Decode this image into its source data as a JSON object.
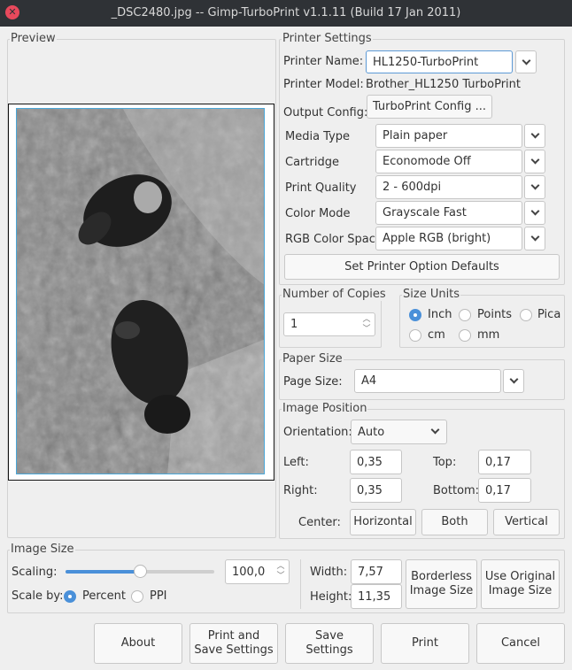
{
  "window": {
    "title": "_DSC2480.jpg -- Gimp-TurboPrint v1.1.11 (Build 17 Jan 2011)"
  },
  "preview": {
    "label": "Preview"
  },
  "printer_settings": {
    "label": "Printer Settings",
    "printer_name_label": "Printer Name:",
    "printer_name_value": "HL1250-TurboPrint",
    "printer_model_label": "Printer Model:",
    "printer_model_value": "Brother_HL1250 TurboPrint",
    "output_config_label": "Output Config:",
    "output_config_button": "TurboPrint Config ...",
    "media_type_label": "Media Type",
    "media_type_value": "Plain paper",
    "cartridge_label": "Cartridge",
    "cartridge_value": "Economode Off",
    "print_quality_label": "Print Quality",
    "print_quality_value": "2 - 600dpi",
    "color_mode_label": "Color Mode",
    "color_mode_value": "Grayscale Fast",
    "rgb_color_space_label": "RGB Color Space",
    "rgb_color_space_value": "Apple RGB (bright)",
    "defaults_button": "Set Printer Option Defaults"
  },
  "copies": {
    "label": "Number of Copies",
    "value": "1"
  },
  "size_units": {
    "label": "Size Units",
    "options": [
      "Inch",
      "Points",
      "Pica",
      "cm",
      "mm"
    ],
    "selected": "Inch"
  },
  "paper_size": {
    "label": "Paper Size",
    "page_size_label": "Page Size:",
    "page_size_value": "A4"
  },
  "image_position": {
    "label": "Image Position",
    "orientation_label": "Orientation:",
    "orientation_value": "Auto",
    "left_label": "Left:",
    "left_value": "0,35",
    "top_label": "Top:",
    "top_value": "0,17",
    "right_label": "Right:",
    "right_value": "0,35",
    "bottom_label": "Bottom:",
    "bottom_value": "0,17",
    "center_label": "Center:",
    "horizontal_button": "Horizontal",
    "both_button": "Both",
    "vertical_button": "Vertical"
  },
  "image_size": {
    "label": "Image Size",
    "scaling_label": "Scaling:",
    "scaling_value": "100,0",
    "scaling_fraction": 0.5,
    "scale_by_label": "Scale by:",
    "scale_by_options": [
      "Percent",
      "PPI"
    ],
    "scale_by_selected": "Percent",
    "width_label": "Width:",
    "width_value": "7,57",
    "height_label": "Height:",
    "height_value": "11,35",
    "borderless_button_line1": "Borderless",
    "borderless_button_line2": "Image Size",
    "original_button_line1": "Use Original",
    "original_button_line2": "Image Size"
  },
  "footer": {
    "about": "About",
    "print_save_line1": "Print and",
    "print_save_line2": "Save Settings",
    "save_line1": "Save",
    "save_line2": "Settings",
    "print": "Print",
    "cancel": "Cancel"
  },
  "colors": {
    "accent": "#4a90d9",
    "titlebar": "#2f3236",
    "close": "#e8495c",
    "background": "#efefef"
  }
}
